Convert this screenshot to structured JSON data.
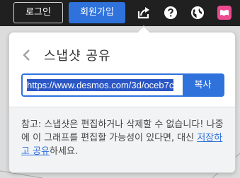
{
  "topbar": {
    "login_label": "로그인",
    "signup_label": "회원가입",
    "signup_color": "#2f72dc",
    "icons": [
      "share-icon",
      "help-icon",
      "globe-icon",
      "brand-icon"
    ]
  },
  "share_popover": {
    "title": "스냅샷 공유",
    "url_value": "https://www.desmos.com/3d/oceb7c",
    "copy_label": "복사",
    "note_prefix": "참고: 스냅샷은 편집하거나 삭제할 수 없습니다! 나중에 이 그래프를 편집할 가능성이 있다면, 대신 ",
    "note_link": "저장하고 공유",
    "note_suffix": "하세요."
  },
  "colors": {
    "accent": "#2f72dc",
    "topbar_bg": "#202020",
    "brand_pink": "#ec4b8f"
  }
}
